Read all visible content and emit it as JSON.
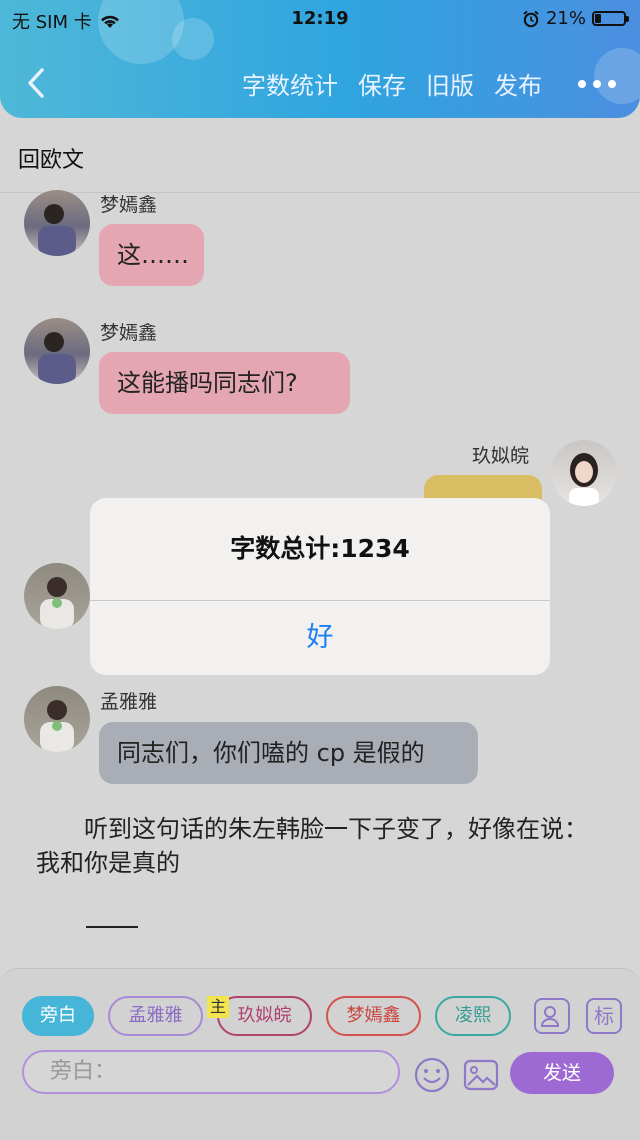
{
  "status_bar": {
    "carrier": "无 SIM 卡",
    "time": "12:19",
    "battery": "21%",
    "battery_level": 0.21
  },
  "header": {
    "actions": [
      "字数统计",
      "保存",
      "旧版",
      "发布"
    ]
  },
  "document": {
    "title": "回欧文"
  },
  "messages": [
    {
      "sender": "梦嫣鑫",
      "text": "这……",
      "side": "left",
      "color": "#e4a6b2"
    },
    {
      "sender": "梦嫣鑫",
      "text": "这能播吗同志们?",
      "side": "left",
      "color": "#e4a6b2"
    },
    {
      "sender": "玖姒皖",
      "text": "",
      "side": "right",
      "color": "#d9bd63"
    },
    {
      "sender": "",
      "text": "",
      "side": "left",
      "color": "#a9adb5"
    },
    {
      "sender": "孟雅雅",
      "text": "同志们，你们嗑的 cp 是假的",
      "side": "left",
      "color": "#a9adb5"
    }
  ],
  "narration": "听到这句话的朱左韩脸一下子变了，好像在说：我和你是真的",
  "dialog": {
    "message": "字数总计:1234",
    "ok": "好"
  },
  "composer": {
    "roles": [
      "旁白",
      "孟雅雅",
      "玖姒皖",
      "梦嫣鑫",
      "凌熙"
    ],
    "host_tag": "主",
    "tag_button": "标",
    "input_placeholder": "旁白：",
    "send": "发送"
  }
}
